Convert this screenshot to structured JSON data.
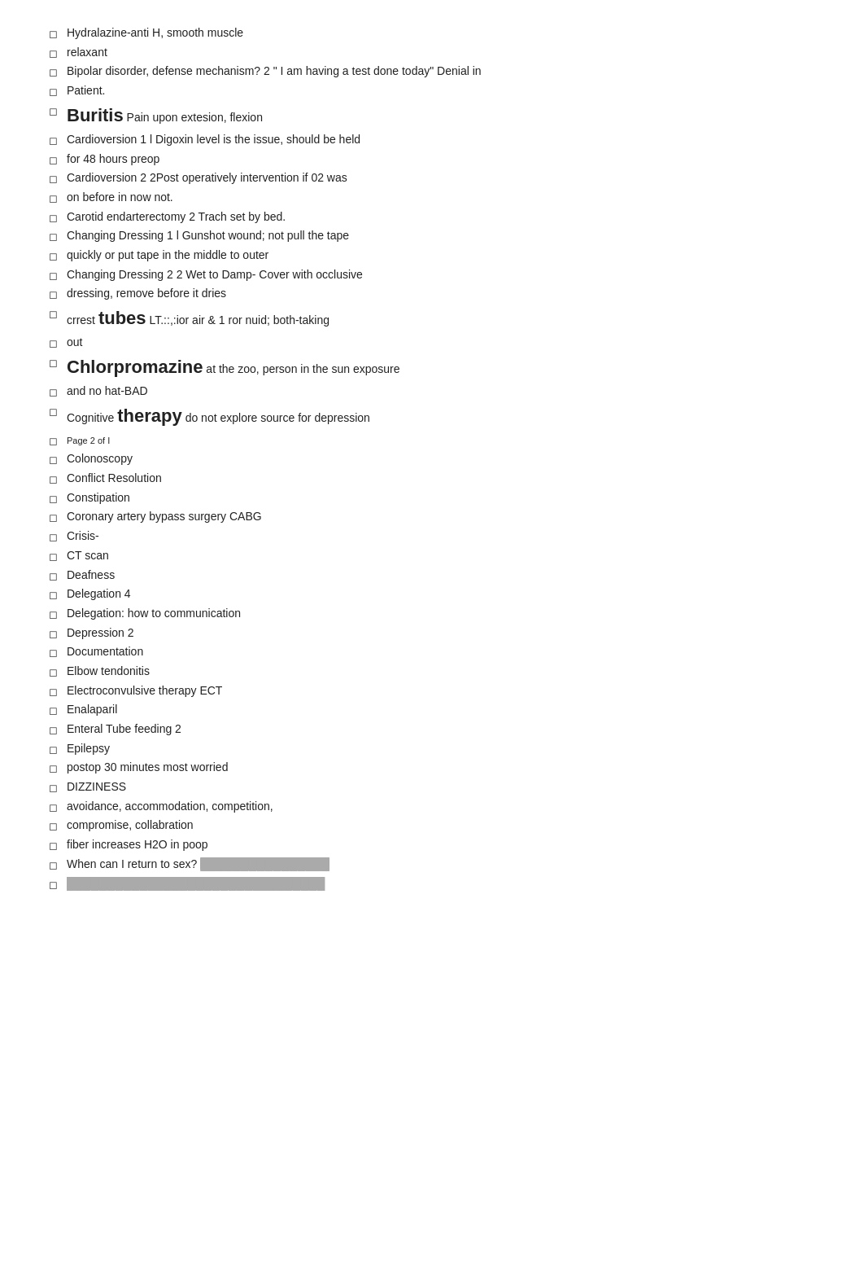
{
  "items": [
    {
      "bullet": "◻",
      "text": "Hydralazine-anti  H, smooth  muscle"
    },
    {
      "bullet": "◻",
      "text": "relaxant"
    },
    {
      "bullet": "◻",
      "text": "Bipolar disorder, defense    mechanism?  2 \" I am having  a test  done  today\" Denial in"
    },
    {
      "bullet": "◻",
      "text": "Patient."
    },
    {
      "bullet": "◻",
      "text": "<span class='large-text'>Buritis</span>  Pain upon extesion,  flexion"
    },
    {
      "bullet": "◻",
      "text": "Cardioversion  1  l Digoxin level is  the  issue,  should  be held"
    },
    {
      "bullet": "◻",
      "text": "for 48 hours preop"
    },
    {
      "bullet": "◻",
      "text": "Cardioversion  2  2Post operatively  intervention  if 02 was"
    },
    {
      "bullet": "◻",
      "text": "on before in now not."
    },
    {
      "bullet": "◻",
      "text": "Carotid endarterectomy    2  Trach set by bed."
    },
    {
      "bullet": "◻",
      "text": "Changing Dressing  1  l Gunshot  wound;  not  pull the tape"
    },
    {
      "bullet": "◻",
      "text": "quickly or put tape   in the middle  to outer"
    },
    {
      "bullet": "◻",
      "text": "Changing Dressing  2  2 Wet to Damp-  Cover  with occlusive"
    },
    {
      "bullet": "◻",
      "text": "dressing,  remove before   it dries"
    },
    {
      "bullet": "◻",
      "text": "crrest  <span class='large-text'>tubes</span>   LT.::,:ior  air &amp; 1 ror nuid; both-taking"
    },
    {
      "bullet": "◻",
      "text": "out"
    },
    {
      "bullet": "◻",
      "text": "<span class='large-text'>Chlorpromazine</span>    at the zoo, person   in the  sun exposure"
    },
    {
      "bullet": "◻",
      "text": "and no  hat-BAD"
    },
    {
      "bullet": "◻",
      "text": "Cognitive <span class='large-text'>therapy</span>   do not explore   source  for depression"
    },
    {
      "bullet": "◻",
      "text": "<span class='page-label'>Page 2  of I</span>"
    },
    {
      "bullet": "◻",
      "text": "Colonoscopy"
    },
    {
      "bullet": "◻",
      "text": "Conflict Resolution"
    },
    {
      "bullet": "◻",
      "text": "Constipation"
    },
    {
      "bullet": "◻",
      "text": "Coronary  artery bypass  surgery  CABG"
    },
    {
      "bullet": "◻",
      "text": "Crisis-"
    },
    {
      "bullet": "◻",
      "text": "CT  scan"
    },
    {
      "bullet": "◻",
      "text": "Deafness"
    },
    {
      "bullet": "◻",
      "text": "Delegation  4"
    },
    {
      "bullet": "◻",
      "text": "Delegation: how   to  communication"
    },
    {
      "bullet": "◻",
      "text": "Depression  2"
    },
    {
      "bullet": "◻",
      "text": "Documentation"
    },
    {
      "bullet": "◻",
      "text": "Elbow  tendonitis"
    },
    {
      "bullet": "◻",
      "text": "Electroconvulsive  therapy  ECT"
    },
    {
      "bullet": "◻",
      "text": "Enalaparil"
    },
    {
      "bullet": "◻",
      "text": "Enteral  Tube  feeding  2"
    },
    {
      "bullet": "◻",
      "text": "Epilepsy"
    },
    {
      "bullet": "◻",
      "text": "postop 30 minutes    most worried"
    },
    {
      "bullet": "◻",
      "text": "DIZZINESS"
    },
    {
      "bullet": "◻",
      "text": "avoidance,  accommodation, competition,"
    },
    {
      "bullet": "◻",
      "text": "compromise, collabration"
    },
    {
      "bullet": "◻",
      "text": "fiber increases   H2O in poop"
    },
    {
      "bullet": "◻",
      "text": "When can   I return  to sex?  <span class='redacted'>████████████████</span>"
    },
    {
      "bullet": "◻",
      "text": "<span class='redacted'>████████████████████████████████</span>"
    }
  ]
}
